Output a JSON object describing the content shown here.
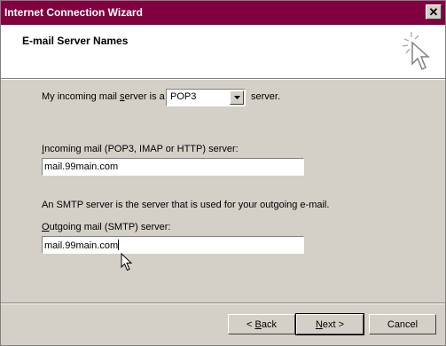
{
  "window": {
    "title": "Internet Connection Wizard"
  },
  "header": {
    "heading": "E-mail Server Names"
  },
  "incoming_type": {
    "prefix": "My incoming mail server is a",
    "underline_char": "s",
    "selected": "POP3",
    "suffix": "server."
  },
  "incoming": {
    "label_first": "I",
    "label_rest": "ncoming mail (POP3, IMAP or HTTP) server:",
    "value": "mail.99main.com"
  },
  "smtp_note": "An SMTP server is the server that is used for your outgoing e-mail.",
  "outgoing": {
    "label_first": "O",
    "label_rest": "utgoing mail (SMTP) server:",
    "value": "mail.99main.com"
  },
  "buttons": {
    "back_first": "B",
    "back_rest": "ack",
    "back_prefix": "< ",
    "next_first": "N",
    "next_rest": "ext >",
    "cancel": "Cancel"
  },
  "icons": [
    "close-icon",
    "wizard-sparkle-icon",
    "dropdown-arrow-icon",
    "mouse-pointer-icon"
  ]
}
